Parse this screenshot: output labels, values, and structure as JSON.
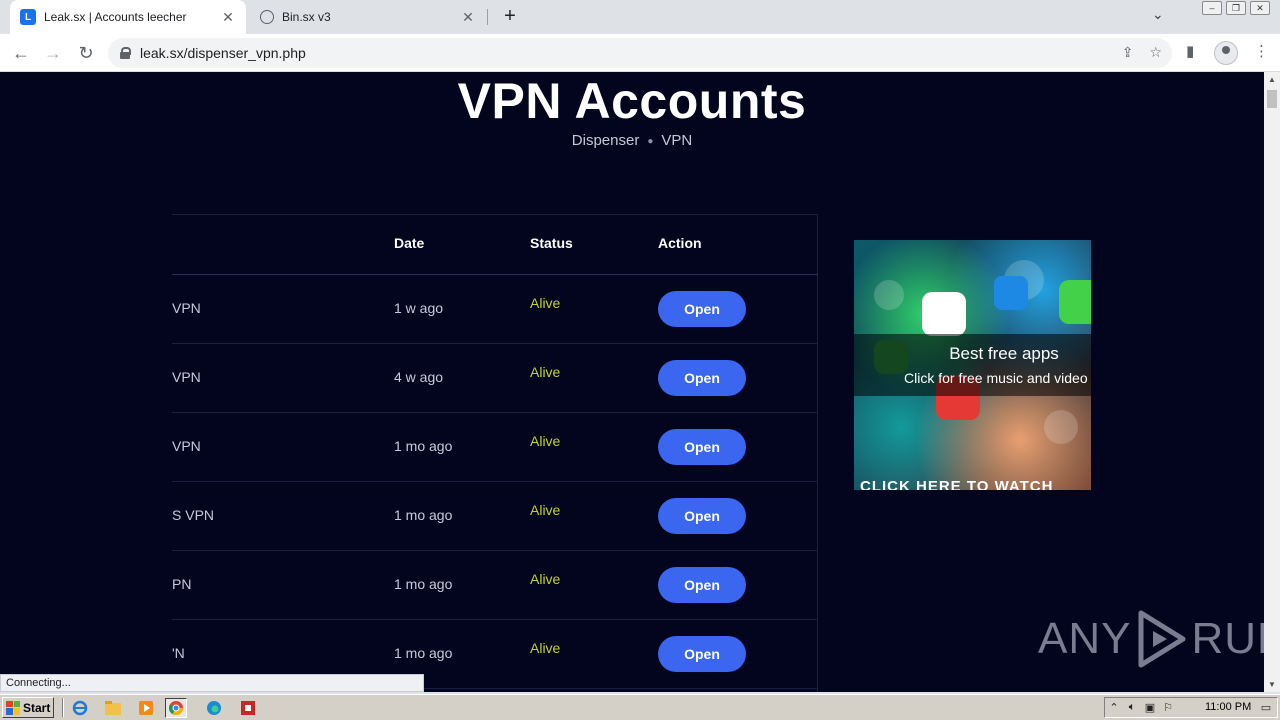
{
  "browser": {
    "tabs": [
      {
        "title": "Leak.sx | Accounts leecher",
        "favicon": "L",
        "active": true
      },
      {
        "title": "Bin.sx v3",
        "favicon": "globe-icon",
        "active": false
      }
    ],
    "url": "leak.sx/dispenser_vpn.php",
    "status_text": "Connecting..."
  },
  "page": {
    "title": "VPN Accounts",
    "breadcrumb": [
      "Dispenser",
      "VPN"
    ],
    "table": {
      "headers": {
        "date": "Date",
        "status": "Status",
        "action": "Action"
      },
      "rows": [
        {
          "name": "VPN",
          "date": "1 w ago",
          "status": "Alive",
          "action": "Open"
        },
        {
          "name": "VPN",
          "date": "4 w ago",
          "status": "Alive",
          "action": "Open"
        },
        {
          "name": "VPN",
          "date": "1 mo ago",
          "status": "Alive",
          "action": "Open"
        },
        {
          "name": "S VPN",
          "date": "1 mo ago",
          "status": "Alive",
          "action": "Open"
        },
        {
          "name": "PN",
          "date": "1 mo ago",
          "status": "Alive",
          "action": "Open"
        },
        {
          "name": "'N",
          "date": "1 mo ago",
          "status": "Alive",
          "action": "Open"
        }
      ]
    },
    "ad": {
      "headline": "Best free apps",
      "subtext": "Click for free music and video",
      "cta": "CLICK HERE TO WATCH"
    },
    "watermark": {
      "left": "ANY",
      "right": "RUN"
    }
  },
  "taskbar": {
    "start_label": "Start",
    "clock": "11:00 PM"
  },
  "colors": {
    "page_bg": "#03051e",
    "button": "#3a66f0",
    "status_alive": "#c2d12c"
  }
}
